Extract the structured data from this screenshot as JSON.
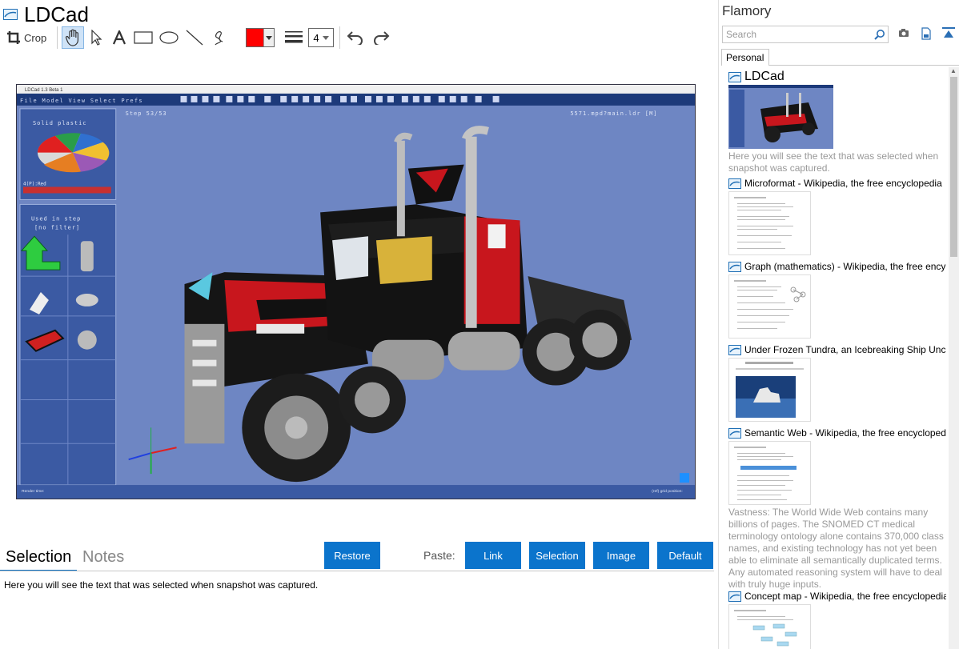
{
  "app": {
    "title": "LDCad"
  },
  "toolbar": {
    "crop_label": "Crop",
    "line_width": "4",
    "color": "#ff0000"
  },
  "screenshot": {
    "window_title": "LDCad 1.3 Beta 1",
    "menu": "File Model View Select Prefs",
    "step": "Step 53/53",
    "file": "5571.mpd?main.ldr [M]",
    "solid_plastic": "Solid plastic",
    "color_label": "4(P):Red",
    "used_in_step": "Used in step",
    "no_filter": "[no filter]",
    "render_time": "Render time:",
    "grid_position": "(ref) grid position:"
  },
  "tabs": {
    "selection": "Selection",
    "notes": "Notes"
  },
  "buttons": {
    "restore": "Restore",
    "paste_label": "Paste:",
    "link": "Link",
    "selection": "Selection",
    "image": "Image",
    "default": "Default"
  },
  "selection_text": "Here you will see the text that was selected when snapshot was captured.",
  "sidebar": {
    "brand": "Flamory",
    "search_placeholder": "Search",
    "tab": "Personal",
    "items": [
      {
        "title": "LDCad",
        "desc": "Here you will see the text that was selected when snapshot was captured."
      },
      {
        "title": "Microformat - Wikipedia, the free encyclopedia"
      },
      {
        "title": "Graph (mathematics) - Wikipedia, the free encyclopedia"
      },
      {
        "title": "Under Frozen Tundra, an Icebreaking Ship Uncovers..."
      },
      {
        "title": "Semantic Web - Wikipedia, the free encyclopedia",
        "desc": "Vastness: The World Wide Web contains many billions of pages. The SNOMED CT medical terminology ontology alone contains 370,000 class names, and existing technology has not yet been able to eliminate all semantically duplicated terms. Any automated reasoning system will have to deal with truly huge inputs."
      },
      {
        "title": "Concept map - Wikipedia, the free encyclopedia"
      }
    ]
  },
  "colors": {
    "accent": "#0b74cc",
    "viewport_bg": "#6e86c3"
  }
}
